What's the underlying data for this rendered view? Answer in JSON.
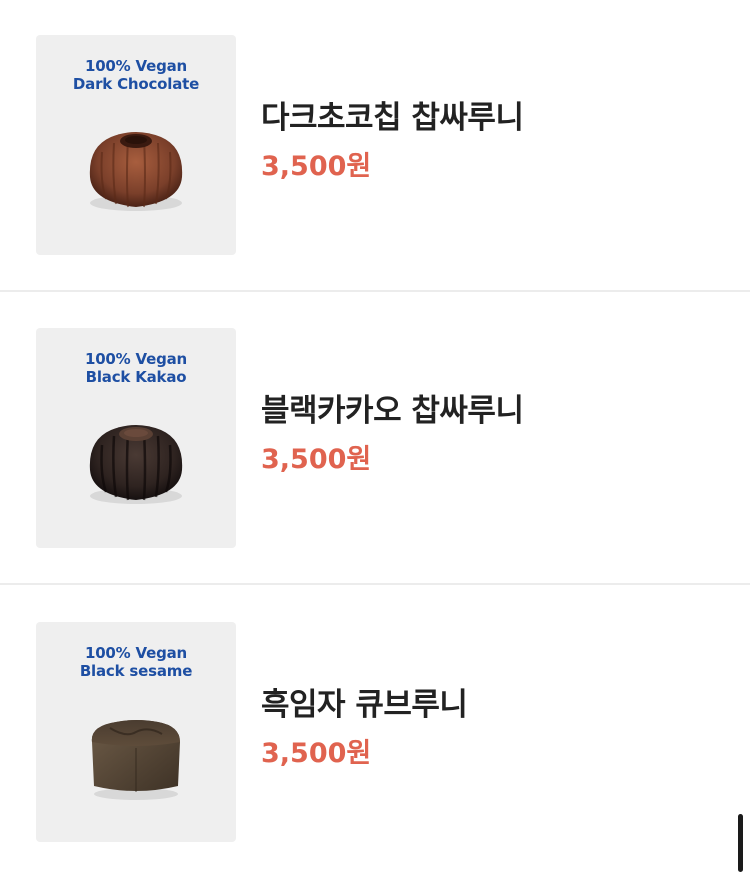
{
  "products": [
    {
      "caption_line1": "100% Vegan",
      "caption_line2": "Dark Chocolate",
      "name": "다크초코칩 찹싸루니",
      "price": "3,500원",
      "cake_color": "#7a3f2a"
    },
    {
      "caption_line1": "100% Vegan",
      "caption_line2": "Black Kakao",
      "name": "블랙카카오 찹싸루니",
      "price": "3,500원",
      "cake_color": "#2e2320"
    },
    {
      "caption_line1": "100% Vegan",
      "caption_line2": "Black sesame",
      "name": "흑임자 큐브루니",
      "price": "3,500원",
      "cake_color": "#5a4a3a"
    }
  ],
  "colors": {
    "caption": "#1e4fa3",
    "price": "#e0634f",
    "name": "#222222",
    "divider": "#ececec"
  }
}
